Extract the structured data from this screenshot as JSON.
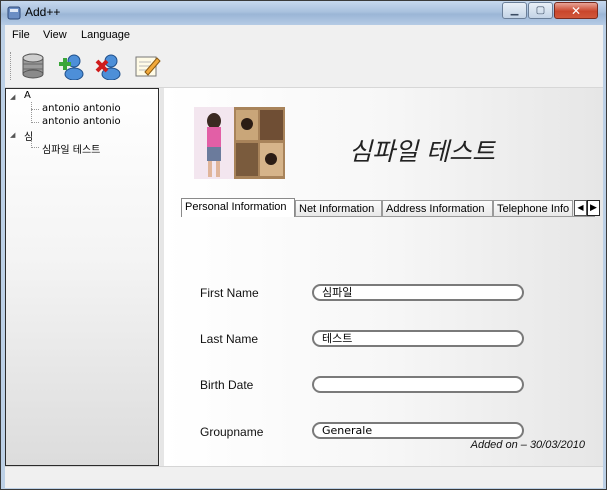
{
  "window": {
    "title": "Add++",
    "controls": [
      "minimize",
      "maximize",
      "close"
    ]
  },
  "menu": [
    "File",
    "View",
    "Language"
  ],
  "toolbar": {
    "buttons": [
      "database-icon",
      "add-contact-icon",
      "delete-contact-icon",
      "edit-icon"
    ]
  },
  "tree": {
    "groups": [
      {
        "label": "A",
        "items": [
          "antonio antonio",
          "antonio antonio"
        ]
      },
      {
        "label": "심",
        "items": [
          "심파일 테스트"
        ]
      }
    ]
  },
  "contact": {
    "display_name": "심파일 테스트",
    "tabs": [
      "Personal Information",
      "Net Information",
      "Address Information",
      "Telephone Info"
    ],
    "active_tab": "Personal Information",
    "fields": [
      {
        "label": "First Name",
        "value": "심파일"
      },
      {
        "label": "Last Name",
        "value": "테스트"
      },
      {
        "label": "Birth Date",
        "value": ""
      },
      {
        "label": "Groupname",
        "value": "Generale"
      }
    ],
    "added_on": "Added on – 30/03/2010"
  },
  "colors": {
    "accent_green": "#3aa63a",
    "delete_red": "#d01c1c",
    "close_button": "#c9462c"
  }
}
